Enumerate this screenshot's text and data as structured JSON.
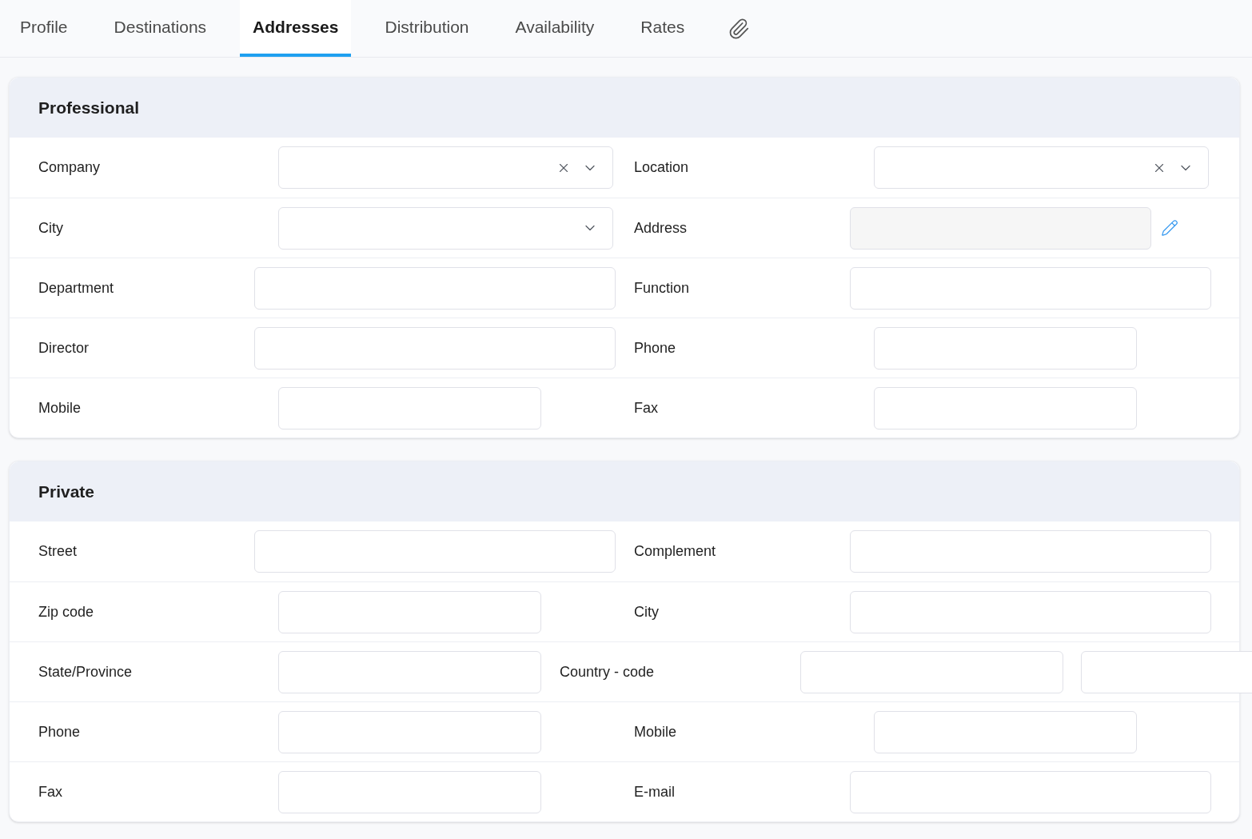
{
  "tabs": [
    {
      "label": "Profile",
      "selected": false
    },
    {
      "label": "Destinations",
      "selected": false
    },
    {
      "label": "Addresses",
      "selected": true
    },
    {
      "label": "Distribution",
      "selected": false
    },
    {
      "label": "Availability",
      "selected": false
    },
    {
      "label": "Rates",
      "selected": false
    }
  ],
  "sections": [
    {
      "title": "Professional",
      "rows": [
        {
          "left": {
            "label": "Company",
            "kind": "select",
            "clearable": true
          },
          "right": {
            "label": "Location",
            "kind": "select",
            "clearable": true
          }
        },
        {
          "left": {
            "label": "City",
            "kind": "select",
            "clearable": false
          },
          "right": {
            "label": "Address",
            "kind": "readonly"
          }
        },
        {
          "left": {
            "label": "Department",
            "kind": "text"
          },
          "right": {
            "label": "Function",
            "kind": "text"
          }
        },
        {
          "left": {
            "label": "Director",
            "kind": "text"
          },
          "right": {
            "label": "Phone",
            "kind": "text"
          }
        },
        {
          "left": {
            "label": "Mobile",
            "kind": "text"
          },
          "right": {
            "label": "Fax",
            "kind": "text"
          }
        }
      ]
    },
    {
      "title": "Private",
      "rows": [
        {
          "left": {
            "label": "Street",
            "kind": "text"
          },
          "right": {
            "label": "Complement",
            "kind": "text"
          }
        },
        {
          "left": {
            "label": "Zip code",
            "kind": "text"
          },
          "right": {
            "label": "City",
            "kind": "text"
          }
        },
        {
          "left": {
            "label": "State/Province",
            "kind": "text"
          },
          "right": {
            "label": "Country - code",
            "kind": "pair"
          }
        },
        {
          "left": {
            "label": "Phone",
            "kind": "text"
          },
          "right": {
            "label": "Mobile",
            "kind": "text"
          }
        },
        {
          "left": {
            "label": "Fax",
            "kind": "text"
          },
          "right": {
            "label": "E-mail",
            "kind": "text"
          }
        }
      ]
    }
  ]
}
